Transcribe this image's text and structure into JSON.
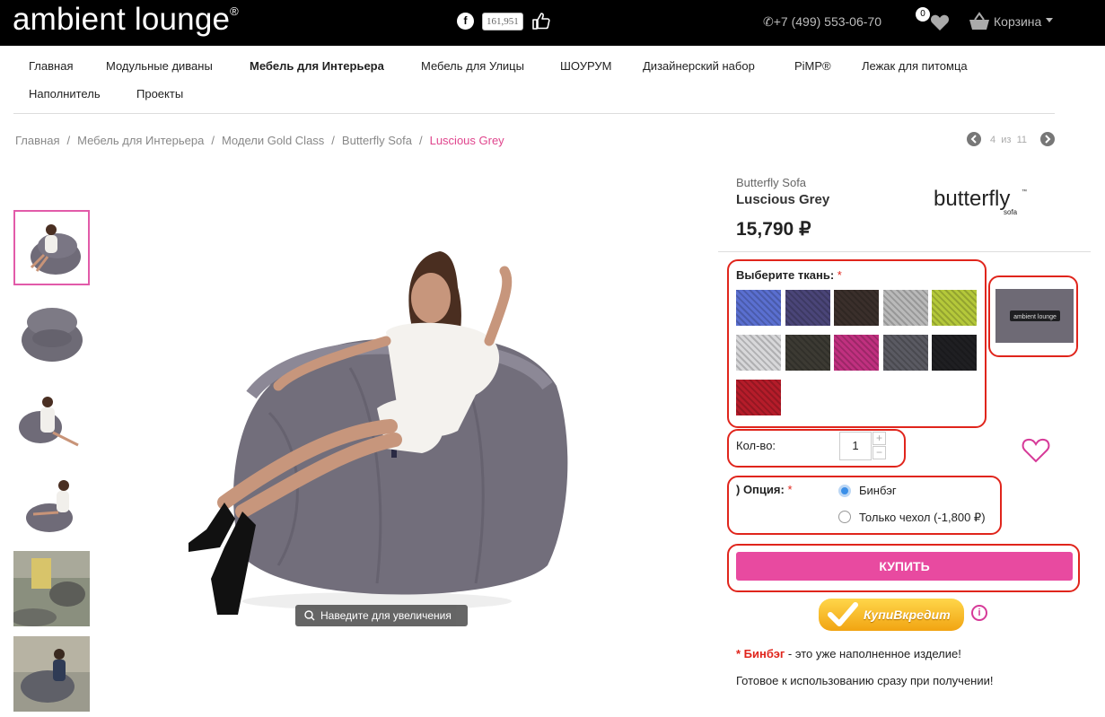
{
  "header": {
    "logo_text": "ambient lounge",
    "logo_mark": "®",
    "facebook_label": "f",
    "like_count": "161,951",
    "phone": "+7 (499) 553-06-70",
    "wishlist_count": "0",
    "cart_label": "Корзина"
  },
  "nav": {
    "items": [
      "Главная",
      "Модульные диваны",
      "Мебель для Интерьера",
      "Мебель для Улицы",
      "ШОУРУМ",
      "Дизайнерский набор",
      "PiMP®",
      "Лежак для питомца",
      "Наполнитель",
      "Проекты"
    ],
    "active_index": 2
  },
  "breadcrumb": {
    "items": [
      "Главная",
      "Мебель для Интерьера",
      "Модели Gold Class",
      "Butterfly Sofa"
    ],
    "current": "Luscious Grey",
    "separator": "/"
  },
  "pager": {
    "current": "4",
    "of": "из",
    "total": "11"
  },
  "gallery": {
    "zoom_hint": "Наведите для увеличения",
    "selected_thumb": 0,
    "thumb_count": 6
  },
  "product": {
    "collection": "Butterfly Sofa",
    "name": "Luscious Grey",
    "price": "15,790 ₽",
    "brand_logo_text": "butterfly",
    "brand_logo_sub": "sofa",
    "brand_logo_tm": "™"
  },
  "fabric": {
    "label": "Выберите ткань:",
    "required_mark": "*",
    "swatches": [
      {
        "color": "#5a6fd0",
        "name": "blue"
      },
      {
        "color": "#4a4578",
        "name": "purple"
      },
      {
        "color": "#3a2f2b",
        "name": "brown-black"
      },
      {
        "color": "#b9b9b9",
        "name": "light-grey"
      },
      {
        "color": "#b4c83a",
        "name": "lime"
      },
      {
        "color": "#d7d7d9",
        "name": "white-grey"
      },
      {
        "color": "#3c3a33",
        "name": "beige-black"
      },
      {
        "color": "#c0307f",
        "name": "magenta"
      },
      {
        "color": "#5a5a62",
        "name": "grey-black"
      },
      {
        "color": "#1f1f22",
        "name": "black"
      },
      {
        "color": "#b51c2a",
        "name": "red"
      }
    ],
    "preview_label": "ambient lounge"
  },
  "quantity": {
    "label": "Кол-во:",
    "value": "1",
    "plus": "+",
    "minus": "−"
  },
  "option": {
    "label": ") Опция:",
    "required_mark": "*",
    "choices": [
      {
        "label": "Бинбэг",
        "selected": true
      },
      {
        "label": "Только чехол (-1,800 ₽)",
        "selected": false
      }
    ]
  },
  "buy_button": "КУПИТЬ",
  "credit_button": "КупиВкредит",
  "info_icon_label": "i",
  "notes": {
    "line1_mark": "* Бинбэг",
    "line1_rest": " - это уже наполненное изделие!",
    "line2": "Готовое к использованию сразу при получении!"
  },
  "colors": {
    "accent": "#e84aa0",
    "highlight": "#e0251c",
    "topbar": "#000000"
  }
}
